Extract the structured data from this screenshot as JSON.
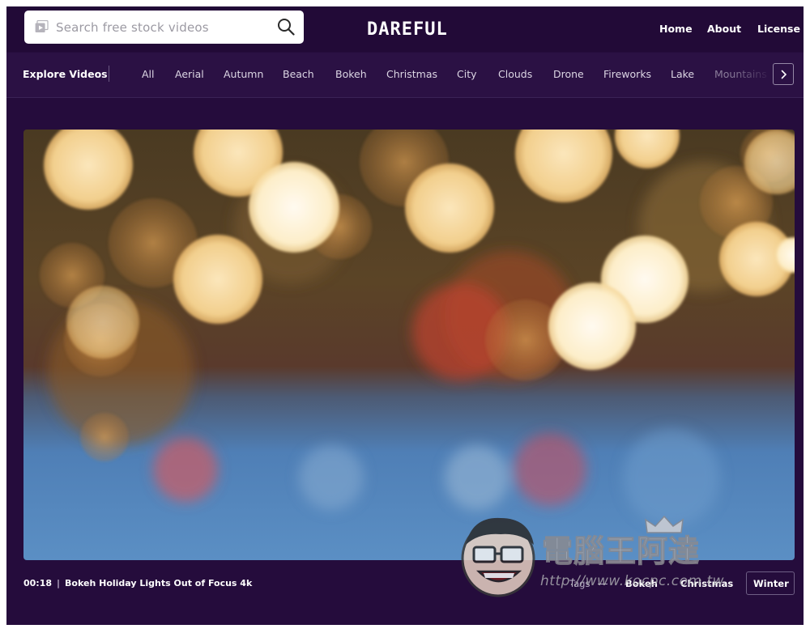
{
  "search": {
    "placeholder": "Search free stock videos"
  },
  "brand": {
    "logo": "DAREFUL"
  },
  "nav": {
    "home": "Home",
    "about": "About",
    "license": "License"
  },
  "categories": {
    "heading": "Explore Videos",
    "items": [
      "All",
      "Aerial",
      "Autumn",
      "Beach",
      "Bokeh",
      "Christmas",
      "City",
      "Clouds",
      "Drone",
      "Fireworks",
      "Lake",
      "Mountains"
    ]
  },
  "video": {
    "duration": "00:18",
    "title": "Bokeh Holiday Lights Out of Focus 4k",
    "tags_label": "Tags",
    "tags": [
      "Bokeh",
      "Christmas",
      "Winter"
    ]
  },
  "watermark": {
    "title": "電腦王阿達",
    "url": "http://www.kocpc.com.tw"
  },
  "colors": {
    "background": "#250c3c",
    "topbar": "#220a37",
    "catbar": "#2b1144",
    "accent": "#ffffff"
  },
  "icons": [
    "video-icon",
    "search-icon",
    "chevron-right-icon",
    "mascot-icon"
  ]
}
